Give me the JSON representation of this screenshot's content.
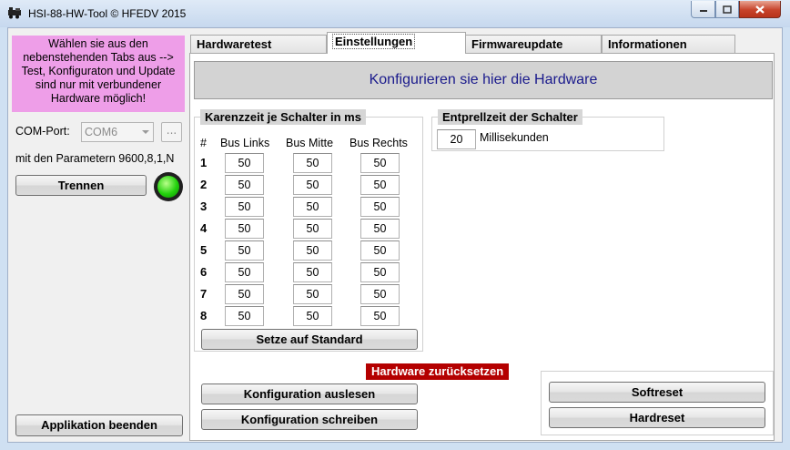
{
  "window": {
    "title": "HSI-88-HW-Tool © HFEDV 2015"
  },
  "left": {
    "info_text": "Wählen sie aus den nebenstehenden Tabs aus --> Test, Konfiguraton und Update sind nur mit verbundener Hardware möglich!",
    "comport_label": "COM-Port:",
    "comport_value": "COM6",
    "browse_label": "...",
    "params_text": "mit den Parametern 9600,8,1,N",
    "disconnect_label": "Trennen",
    "exit_label": "Applikation beenden",
    "status_color": "#22d10c"
  },
  "tabs": [
    {
      "label": "Hardwaretest"
    },
    {
      "label": "Einstellungen"
    },
    {
      "label": "Firmwareupdate"
    },
    {
      "label": "Informationen"
    }
  ],
  "active_tab": "Einstellungen",
  "settings": {
    "banner": "Konfigurieren sie hier die Hardware",
    "karenz": {
      "title": "Karenzzeit je Schalter in ms",
      "hash": "#",
      "columns": [
        "Bus Links",
        "Bus Mitte",
        "Bus Rechts"
      ],
      "rows": [
        {
          "num": "1",
          "values": [
            "50",
            "50",
            "50"
          ]
        },
        {
          "num": "2",
          "values": [
            "50",
            "50",
            "50"
          ]
        },
        {
          "num": "3",
          "values": [
            "50",
            "50",
            "50"
          ]
        },
        {
          "num": "4",
          "values": [
            "50",
            "50",
            "50"
          ]
        },
        {
          "num": "5",
          "values": [
            "50",
            "50",
            "50"
          ]
        },
        {
          "num": "6",
          "values": [
            "50",
            "50",
            "50"
          ]
        },
        {
          "num": "7",
          "values": [
            "50",
            "50",
            "50"
          ]
        },
        {
          "num": "8",
          "values": [
            "50",
            "50",
            "50"
          ]
        }
      ],
      "default_button": "Setze auf Standard"
    },
    "entprell": {
      "title": "Entprellzeit der Schalter",
      "value": "20",
      "unit": "Millisekunden"
    },
    "read_button": "Konfiguration auslesen",
    "write_button": "Konfiguration schreiben",
    "reset": {
      "title": "Hardware zurücksetzen",
      "soft": "Softreset",
      "hard": "Hardreset"
    }
  }
}
